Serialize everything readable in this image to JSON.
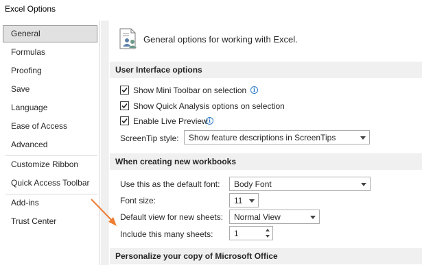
{
  "window": {
    "title": "Excel Options"
  },
  "sidebar": {
    "items": [
      {
        "label": "General",
        "selected": true
      },
      {
        "label": "Formulas"
      },
      {
        "label": "Proofing"
      },
      {
        "label": "Save"
      },
      {
        "label": "Language"
      },
      {
        "label": "Ease of Access"
      },
      {
        "label": "Advanced"
      },
      {
        "label": "Customize Ribbon"
      },
      {
        "label": "Quick Access Toolbar"
      },
      {
        "label": "Add-ins"
      },
      {
        "label": "Trust Center"
      }
    ]
  },
  "main": {
    "header": "General options for working with Excel.",
    "ui_section": {
      "title": "User Interface options",
      "show_mini_toolbar": {
        "label": "Show Mini Toolbar on selection",
        "checked": true
      },
      "show_quick_analysis": {
        "label": "Show Quick Analysis options on selection",
        "checked": true
      },
      "enable_live_preview": {
        "label": "Enable Live Preview",
        "checked": true
      },
      "screentip_label": "ScreenTip style:",
      "screentip_value": "Show feature descriptions in ScreenTips"
    },
    "new_workbooks_section": {
      "title": "When creating new workbooks",
      "default_font_label": "Use this as the default font:",
      "default_font_value": "Body Font",
      "font_size_label": "Font size:",
      "font_size_value": "11",
      "default_view_label": "Default view for new sheets:",
      "default_view_value": "Normal View",
      "sheets_label": "Include this many sheets:",
      "sheets_value": "1"
    },
    "personalize_section": {
      "title": "Personalize your copy of Microsoft Office"
    }
  },
  "colors": {
    "annotation_arrow": "#ed7d31",
    "info_icon": "#2b79c9",
    "section_bar": "#f0f0f0"
  },
  "icons": [
    "options-general-icon",
    "info-icon",
    "checkmark-icon",
    "dropdown-arrow-icon",
    "spin-up-icon",
    "spin-down-icon"
  ]
}
